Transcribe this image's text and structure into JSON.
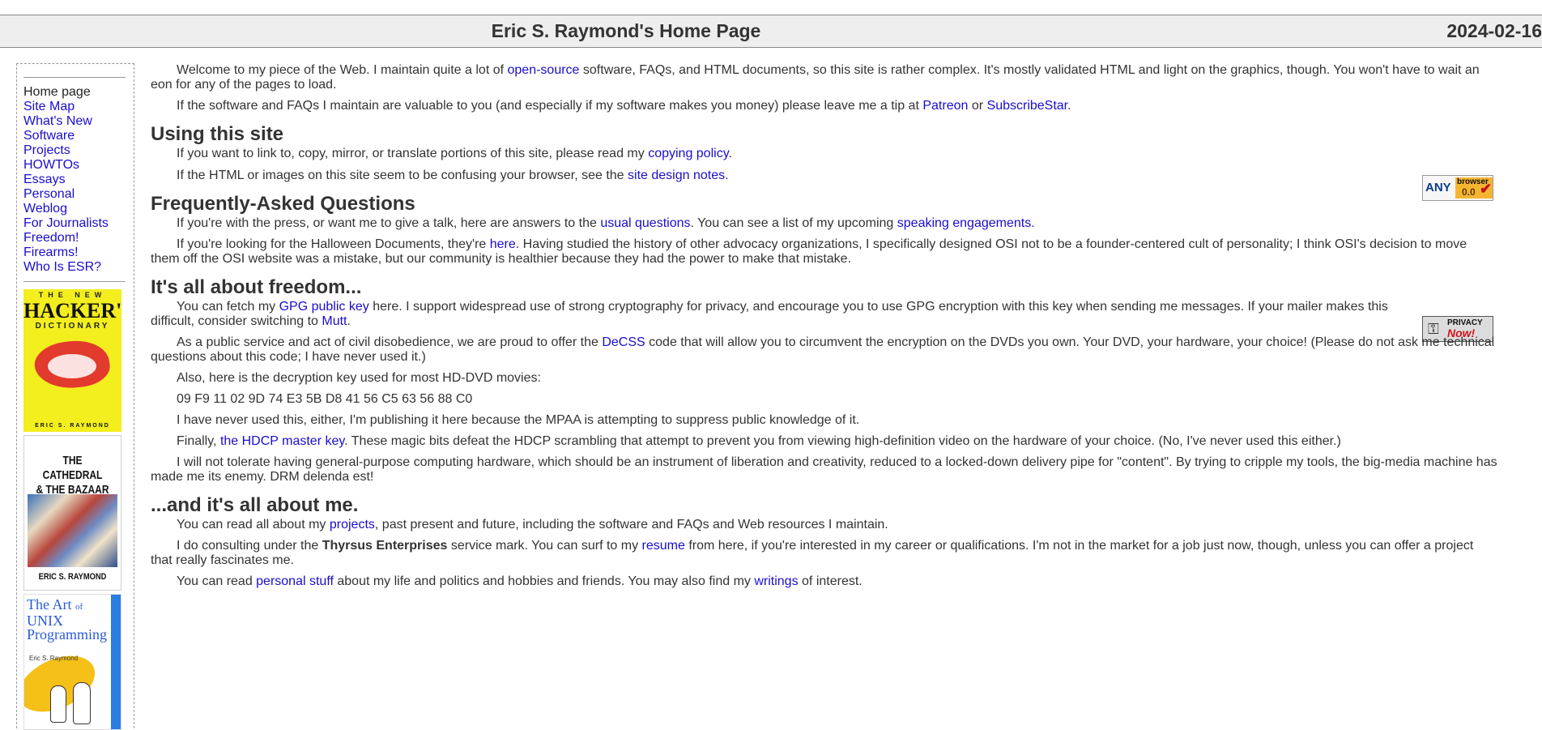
{
  "header": {
    "title": "Eric S. Raymond's Home Page",
    "date": "2024-02-16"
  },
  "sidebar": {
    "nav": [
      {
        "label": "Home page",
        "current": true
      },
      {
        "label": "Site Map"
      },
      {
        "label": "What's New"
      },
      {
        "label": "Software"
      },
      {
        "label": "Projects"
      },
      {
        "label": "HOWTOs"
      },
      {
        "label": "Essays"
      },
      {
        "label": "Personal"
      },
      {
        "label": "Weblog"
      },
      {
        "label": "For Journalists"
      },
      {
        "label": "Freedom!"
      },
      {
        "label": "Firearms!"
      },
      {
        "label": "Who Is ESR?"
      }
    ],
    "books": {
      "hackers": {
        "top": "THE NEW",
        "title": "HACKER'S",
        "sub": "DICTIONARY",
        "author": "ERIC S. RAYMOND"
      },
      "cathedral": {
        "title1": "THE CATHEDRAL",
        "title2": "& THE BAZAAR",
        "author": "ERIC S. RAYMOND"
      },
      "unix": {
        "title1": "The Art",
        "title2": "of",
        "title3": "UNIX",
        "title4": "Programming",
        "author": "Eric S. Raymond"
      }
    }
  },
  "main": {
    "intro": {
      "p1_a": "Welcome to my piece of the Web. I maintain quite a lot of ",
      "p1_link": "open-source",
      "p1_b": " software, FAQs, and HTML documents, so this site is rather complex. It's mostly validated HTML and light on the graphics, though. You won't have to wait an eon for any of the pages to load.",
      "p2_a": "If the software and FAQs I maintain are valuable to you (and especially if my software makes you money) please leave me a tip at ",
      "p2_link1": "Patreon",
      "p2_b": " or ",
      "p2_link2": "SubscribeStar",
      "p2_c": "."
    },
    "using": {
      "heading": "Using this site",
      "p1_a": "If you want to link to, copy, mirror, or translate portions of this site, please read my ",
      "p1_link": "copying policy",
      "p1_b": ".",
      "p2_a": "If the HTML or images on this site seem to be confusing your browser, see the ",
      "p2_link": "site design notes",
      "p2_b": "."
    },
    "faq": {
      "heading": "Frequently-Asked Questions",
      "p1_a": "If you're with the press, or want me to give a talk, here are answers to the ",
      "p1_link1": "usual questions",
      "p1_b": ". You can see a list of my upcoming ",
      "p1_link2": "speaking engagements",
      "p1_c": ".",
      "p2_a": "If you're looking for the Halloween Documents, they're ",
      "p2_link": "here",
      "p2_b": ". Having studied the history of other advocacy organizations, I specifically designed OSI not to be a founder-centered cult of personality; I think OSI's decision to move them off the OSI website was a mistake, but our community is healthier because they had the power to make that mistake."
    },
    "freedom": {
      "heading": "It's all about freedom...",
      "p1_a": "You can fetch my ",
      "p1_link1": "GPG public key",
      "p1_b": " here. I support widespread use of strong cryptography for privacy, and encourage you to use GPG encryption with this key when sending me messages. If your mailer makes this difficult, consider switching to ",
      "p1_link2": "Mutt",
      "p1_c": ".",
      "p2_a": "As a public service and act of civil disobedience, we are proud to offer the ",
      "p2_link": "DeCSS",
      "p2_b": " code that will allow you to circumvent the encryption on the DVDs you own. Your DVD, your hardware, your choice! (Please do not ask me technical questions about this code; I have never used it.)",
      "p3": "Also, here is the decryption key used for most HD-DVD movies:",
      "p4": "09 F9 11 02 9D 74 E3 5B D8 41 56 C5 63 56 88 C0",
      "p5": "I have never used this, either, I'm publishing it here because the MPAA is attempting to suppress public knowledge of it.",
      "p6_a": "Finally, ",
      "p6_link": "the HDCP master key",
      "p6_b": ". These magic bits defeat the HDCP scrambling that attempt to prevent you from viewing high-definition video on the hardware of your choice. (No, I've never used this either.)",
      "p7": "I will not tolerate having general-purpose computing hardware, which should be an instrument of liberation and creativity, reduced to a locked-down delivery pipe for \"content\". By trying to cripple my tools, the big-media machine has made me its enemy. DRM delenda est!"
    },
    "me": {
      "heading": "...and it's all about me.",
      "p1_a": "You can read all about my ",
      "p1_link": "projects",
      "p1_b": ", past present and future, including the software and FAQs and Web resources I maintain.",
      "p2_a": "I do consulting under the ",
      "p2_bold": "Thyrsus Enterprises",
      "p2_b": " service mark. You can surf to my ",
      "p2_link": "resume",
      "p2_c": " from here, if you're interested in my career or qualifications. I'm not in the market for a job just now, though, unless you can offer a project that really fascinates me.",
      "p3_a": "You can read ",
      "p3_link1": "personal stuff",
      "p3_b": " about my life and politics and hobbies and friends. You may also find my ",
      "p3_link2": "writings",
      "p3_c": " of interest."
    },
    "badges": {
      "any_browser": {
        "any": "ANY",
        "browser": "browser",
        "version": "0.0"
      },
      "privacy": {
        "line1": "PRIVACY",
        "line2": "Now!"
      }
    }
  },
  "colors": {
    "link": "#1a0dcc",
    "text": "#333333",
    "header_bg": "#eeeeee"
  }
}
